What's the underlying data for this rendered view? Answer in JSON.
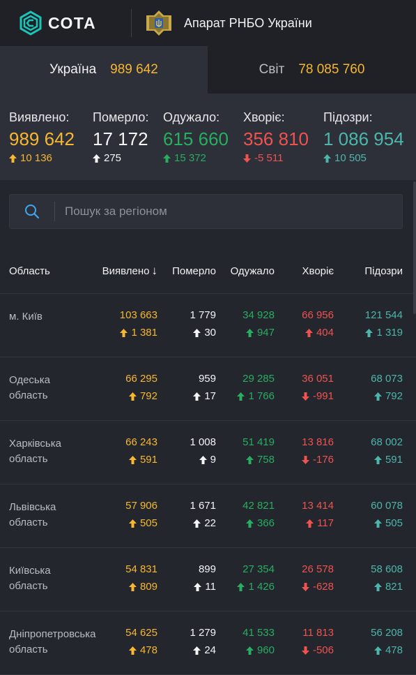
{
  "header": {
    "logo_text": "СОТА",
    "org_name": "Апарат РНБО України"
  },
  "tabs": [
    {
      "label": "Україна",
      "value": "989 642"
    },
    {
      "label": "Світ",
      "value": "78 085 760"
    }
  ],
  "summary": [
    {
      "label": "Виявлено:",
      "value": "989 642",
      "delta": "10 136",
      "dir": "up",
      "color": "yellow"
    },
    {
      "label": "Померло:",
      "value": "17 172",
      "delta": "275",
      "dir": "up",
      "color": "white"
    },
    {
      "label": "Одужало:",
      "value": "615 660",
      "delta": "15 372",
      "dir": "up",
      "color": "green"
    },
    {
      "label": "Хворіє:",
      "value": "356 810",
      "delta": "-5 511",
      "dir": "down",
      "color": "red"
    },
    {
      "label": "Підозри:",
      "value": "1 086 954",
      "delta": "10 505",
      "dir": "up",
      "color": "teal"
    }
  ],
  "search": {
    "placeholder": "Пошук за регіоном"
  },
  "table": {
    "columns": [
      "Область",
      "Виявлено",
      "Померло",
      "Одужало",
      "Хворіє",
      "Підозри"
    ],
    "sort_arrow": "↓",
    "rows": [
      {
        "region": "м. Київ",
        "cells": [
          {
            "v": "103 663",
            "d": "1 381",
            "dir": "up"
          },
          {
            "v": "1 779",
            "d": "30",
            "dir": "up"
          },
          {
            "v": "34 928",
            "d": "947",
            "dir": "up"
          },
          {
            "v": "66 956",
            "d": "404",
            "dir": "up"
          },
          {
            "v": "121 544",
            "d": "1 319",
            "dir": "up"
          }
        ]
      },
      {
        "region": "Одеська область",
        "cells": [
          {
            "v": "66 295",
            "d": "792",
            "dir": "up"
          },
          {
            "v": "959",
            "d": "17",
            "dir": "up"
          },
          {
            "v": "29 285",
            "d": "1 766",
            "dir": "up"
          },
          {
            "v": "36 051",
            "d": "-991",
            "dir": "down"
          },
          {
            "v": "68 073",
            "d": "792",
            "dir": "up"
          }
        ]
      },
      {
        "region": "Харківська область",
        "cells": [
          {
            "v": "66 243",
            "d": "591",
            "dir": "up"
          },
          {
            "v": "1 008",
            "d": "9",
            "dir": "up"
          },
          {
            "v": "51 419",
            "d": "758",
            "dir": "up"
          },
          {
            "v": "13 816",
            "d": "-176",
            "dir": "down"
          },
          {
            "v": "68 002",
            "d": "591",
            "dir": "up"
          }
        ]
      },
      {
        "region": "Львівська область",
        "cells": [
          {
            "v": "57 906",
            "d": "505",
            "dir": "up"
          },
          {
            "v": "1 671",
            "d": "22",
            "dir": "up"
          },
          {
            "v": "42 821",
            "d": "366",
            "dir": "up"
          },
          {
            "v": "13 414",
            "d": "117",
            "dir": "up"
          },
          {
            "v": "60 078",
            "d": "505",
            "dir": "up"
          }
        ]
      },
      {
        "region": "Київська область",
        "cells": [
          {
            "v": "54 831",
            "d": "809",
            "dir": "up"
          },
          {
            "v": "899",
            "d": "11",
            "dir": "up"
          },
          {
            "v": "27 354",
            "d": "1 426",
            "dir": "up"
          },
          {
            "v": "26 578",
            "d": "-628",
            "dir": "down"
          },
          {
            "v": "58 608",
            "d": "821",
            "dir": "up"
          }
        ]
      },
      {
        "region": "Дніпропетровська область",
        "cells": [
          {
            "v": "54 625",
            "d": "478",
            "dir": "up"
          },
          {
            "v": "1 279",
            "d": "24",
            "dir": "up"
          },
          {
            "v": "41 533",
            "d": "960",
            "dir": "up"
          },
          {
            "v": "11 813",
            "d": "-506",
            "dir": "down"
          },
          {
            "v": "56 208",
            "d": "478",
            "dir": "up"
          }
        ]
      }
    ]
  },
  "colors": {
    "yellow": "#f7b731",
    "white": "#f4f5f7",
    "green": "#27ae60",
    "red": "#ef5350",
    "teal": "#4db6ac"
  }
}
